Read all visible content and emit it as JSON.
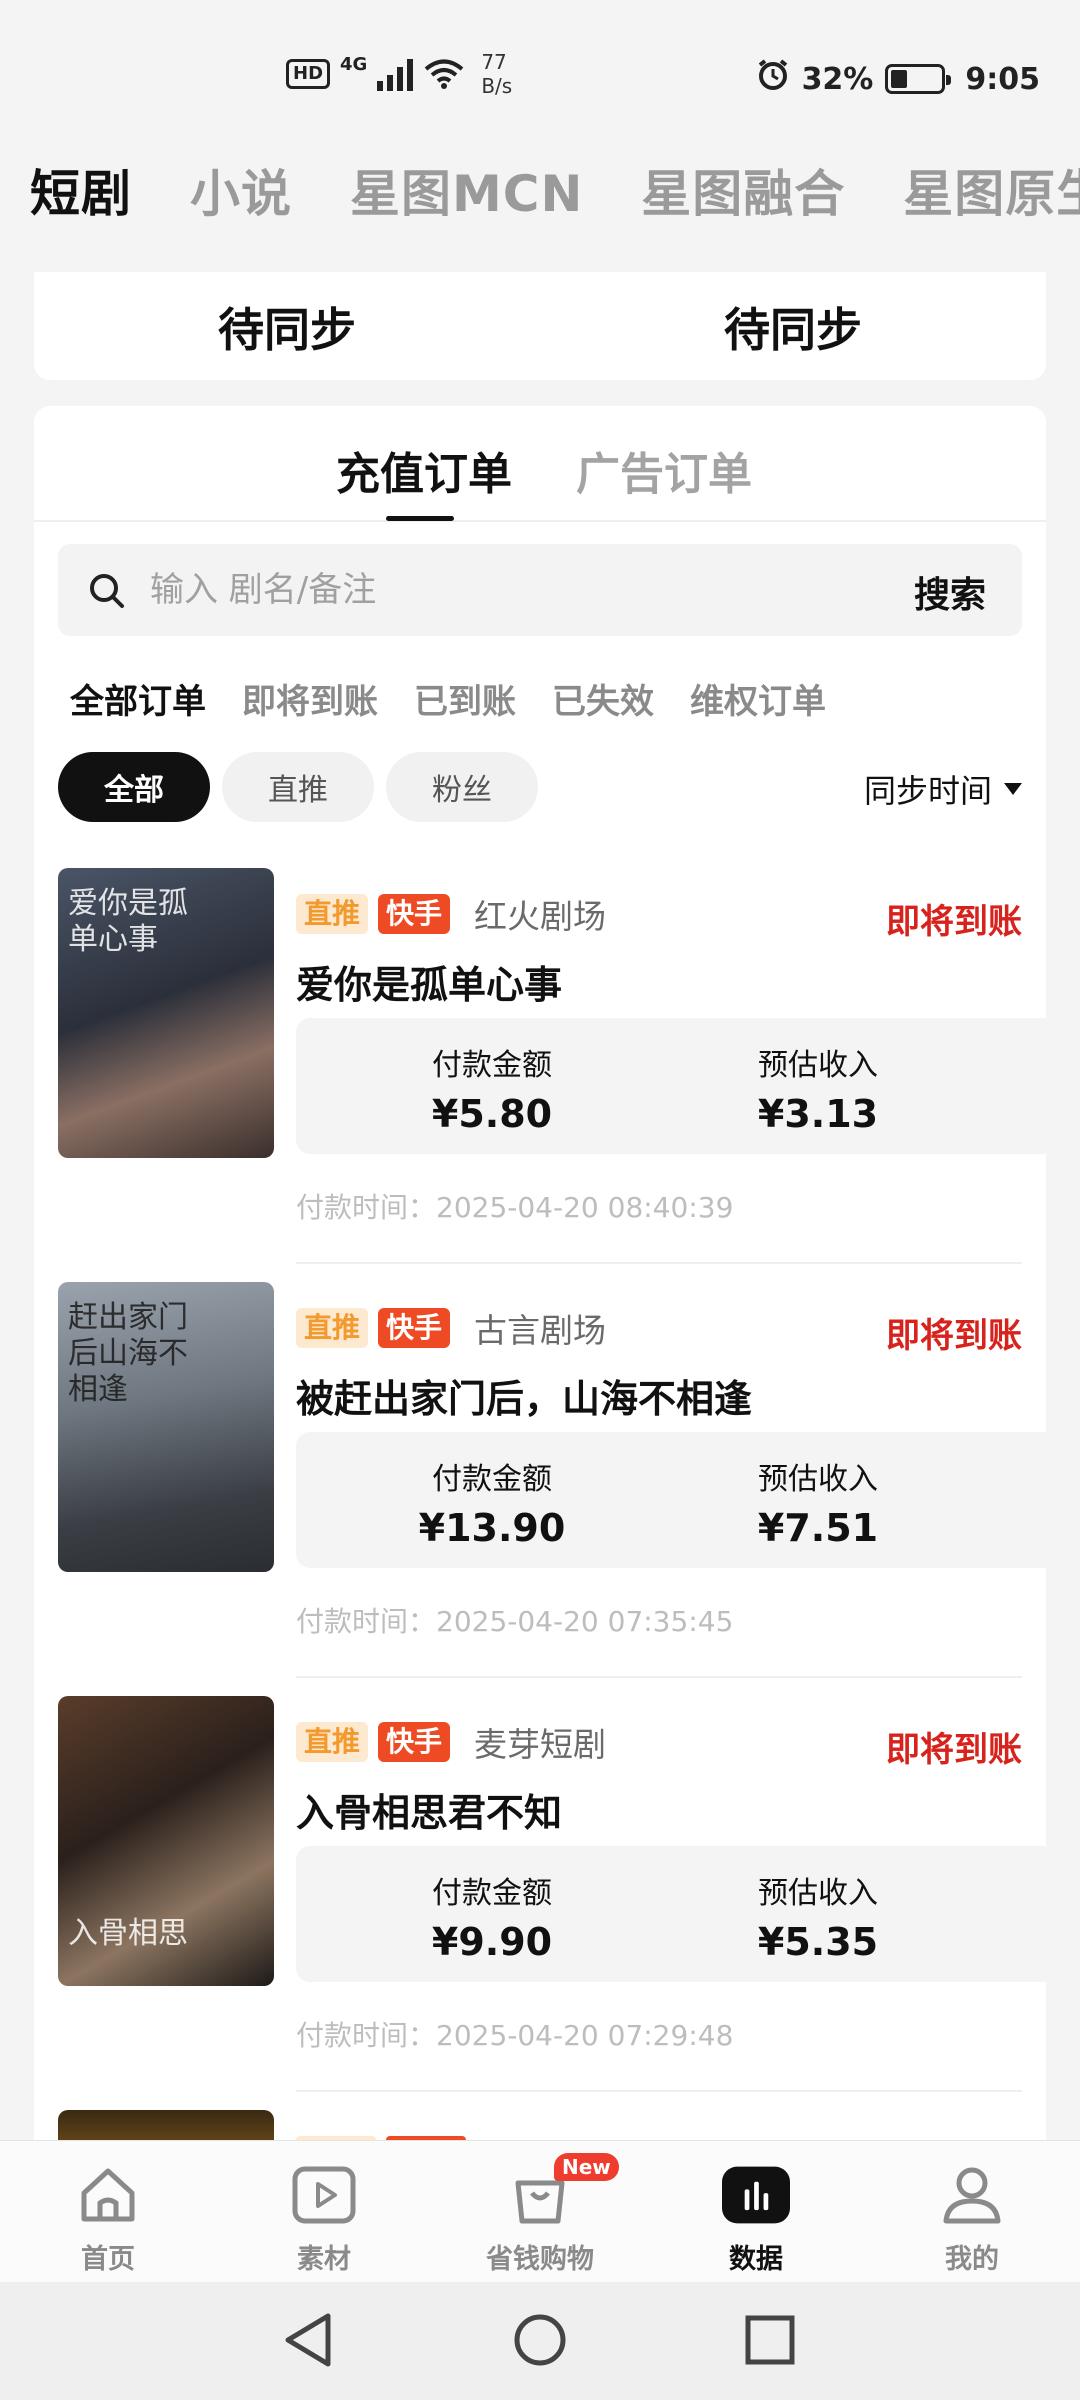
{
  "status_bar": {
    "hd": "HD",
    "network": "4G",
    "speed_value": "77",
    "speed_unit": "B/s",
    "battery": "32%",
    "time": "9:05"
  },
  "top_tabs": [
    "短剧",
    "小说",
    "星图MCN",
    "星图融合",
    "星图原生"
  ],
  "sync": {
    "left_value": "待同步",
    "right_value": "待同步"
  },
  "order_tabs": {
    "recharge": "充值订单",
    "ads": "广告订单"
  },
  "search": {
    "placeholder": "输入 剧名/备注",
    "button": "搜索"
  },
  "status_filters": [
    "全部订单",
    "即将到账",
    "已到账",
    "已失效",
    "维权订单"
  ],
  "chips": [
    "全部",
    "直推",
    "粉丝"
  ],
  "sort_label": "同步时间",
  "orders": [
    {
      "poster_text": "爱你是孤单心事",
      "tag_direct": "直推",
      "tag_platform": "快手",
      "theater": "红火剧场",
      "status": "即将到账",
      "name": "爱你是孤单心事",
      "pay_label": "付款金额",
      "pay_amount": "¥5.80",
      "income_label": "预估收入",
      "income_amount": "¥3.13",
      "pay_time": "付款时间：2025-04-20 08:40:39"
    },
    {
      "poster_text": "赶出家门后山海不相逢",
      "tag_direct": "直推",
      "tag_platform": "快手",
      "theater": "古言剧场",
      "status": "即将到账",
      "name": "被赶出家门后，山海不相逢",
      "pay_label": "付款金额",
      "pay_amount": "¥13.90",
      "income_label": "预估收入",
      "income_amount": "¥7.51",
      "pay_time": "付款时间：2025-04-20 07:35:45"
    },
    {
      "poster_text": "入骨相思",
      "tag_direct": "直推",
      "tag_platform": "快手",
      "theater": "麦芽短剧",
      "status": "即将到账",
      "name": "入骨相思君不知",
      "pay_label": "付款金额",
      "pay_amount": "¥9.90",
      "income_label": "预估收入",
      "income_amount": "¥5.35",
      "pay_time": "付款时间：2025-04-20 07:29:48"
    }
  ],
  "bottom_nav": [
    {
      "label": "首页",
      "icon": "home-icon"
    },
    {
      "label": "素材",
      "icon": "play-icon"
    },
    {
      "label": "省钱购物",
      "icon": "shopping-bag-icon",
      "badge": "New"
    },
    {
      "label": "数据",
      "icon": "chart-icon",
      "active": true
    },
    {
      "label": "我的",
      "icon": "person-icon"
    }
  ],
  "colors": {
    "accent_red": "#d8221c",
    "tag_orange_bg": "#fde9cf",
    "tag_orange_text": "#f29a2e",
    "tag_kuaishou": "#ee4b24"
  }
}
